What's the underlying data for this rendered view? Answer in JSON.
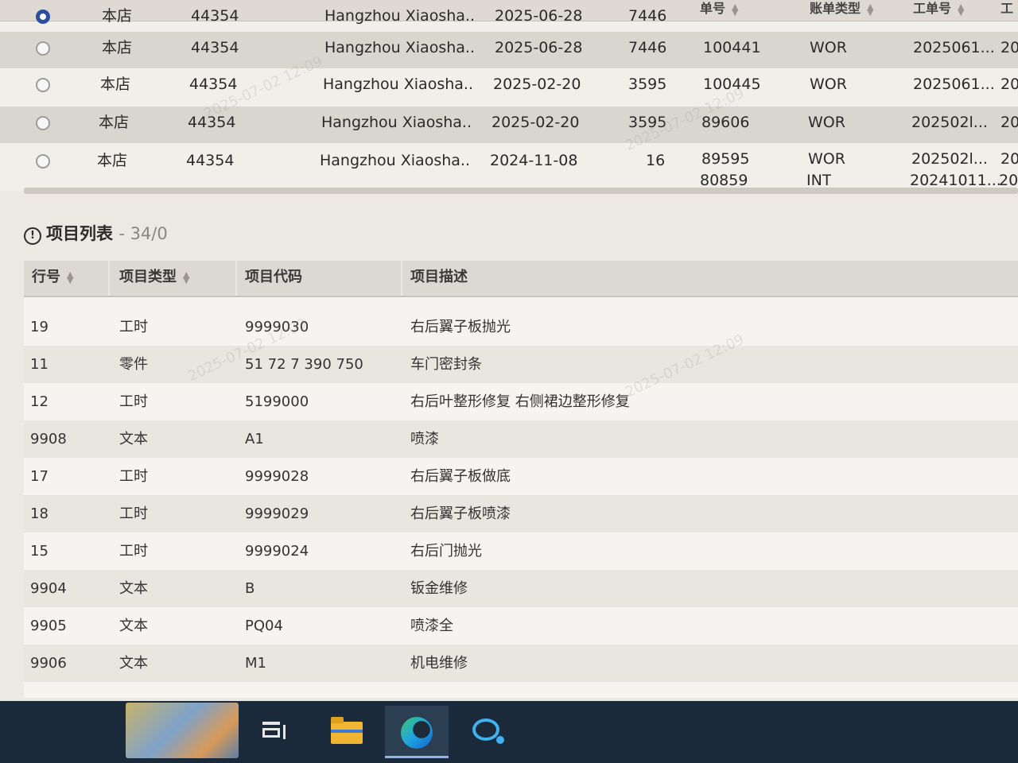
{
  "upper_table": {
    "header_labels": [
      "单号",
      "账单类型",
      "工单号",
      "工"
    ],
    "rows": [
      {
        "selected": true,
        "store": "本店",
        "code": "44354",
        "company": "Hangzhou Xiaosha...",
        "date": "2025-06-28",
        "num": "7446",
        "bill_no": "",
        "type": "",
        "order_no": "",
        "extra": ""
      },
      {
        "selected": false,
        "store": "本店",
        "code": "44354",
        "company": "Hangzhou Xiaosha...",
        "date": "2025-06-28",
        "num": "7446",
        "bill_no": "100441",
        "type": "WOR",
        "order_no": "2025061...",
        "extra": "20"
      },
      {
        "selected": false,
        "store": "本店",
        "code": "44354",
        "company": "Hangzhou Xiaosha...",
        "date": "2025-02-20",
        "num": "3595",
        "bill_no": "100445",
        "type": "WOR",
        "order_no": "2025061...",
        "extra": "20"
      },
      {
        "selected": false,
        "store": "本店",
        "code": "44354",
        "company": "Hangzhou Xiaosha...",
        "date": "2025-02-20",
        "num": "3595",
        "bill_no": "89606",
        "type": "WOR",
        "order_no": "202502l...",
        "extra": "20"
      },
      {
        "selected": false,
        "store": "本店",
        "code": "44354",
        "company": "Hangzhou Xiaosha...",
        "date": "2024-11-08",
        "num": "16",
        "bill_no": "89595",
        "type": "WOR",
        "order_no": "202502l...",
        "extra": "20"
      }
    ],
    "last_row": {
      "bill_no": "80859",
      "type": "INT",
      "order_no": "20241011...",
      "extra": "20"
    }
  },
  "items_section": {
    "title": "项目列表",
    "count": "- 34/0"
  },
  "items_table": {
    "columns": [
      "行号",
      "项目类型",
      "项目代码",
      "项目描述"
    ],
    "rows": [
      {
        "line": "19",
        "type": "工时",
        "code": "9999030",
        "desc": "右后翼子板抛光"
      },
      {
        "line": "11",
        "type": "零件",
        "code": "51 72 7 390 750",
        "desc": "车门密封条"
      },
      {
        "line": "12",
        "type": "工时",
        "code": "5199000",
        "desc": "右后叶整形修复 右侧裙边整形修复"
      },
      {
        "line": "9908",
        "type": "文本",
        "code": "A1",
        "desc": "喷漆"
      },
      {
        "line": "17",
        "type": "工时",
        "code": "9999028",
        "desc": "右后翼子板做底"
      },
      {
        "line": "18",
        "type": "工时",
        "code": "9999029",
        "desc": "右后翼子板喷漆"
      },
      {
        "line": "15",
        "type": "工时",
        "code": "9999024",
        "desc": "右后门抛光"
      },
      {
        "line": "9904",
        "type": "文本",
        "code": "B",
        "desc": "钣金维修"
      },
      {
        "line": "9905",
        "type": "文本",
        "code": "PQ04",
        "desc": "喷漆全"
      },
      {
        "line": "9906",
        "type": "文本",
        "code": "M1",
        "desc": "机电维修"
      }
    ]
  },
  "watermarks": [
    "2025-07-02 12:09",
    "2025-07-02 12:09",
    "2025-07-02 12:09",
    "2025-07-02 12:09"
  ],
  "taskbar": {
    "icons": [
      "task-view-icon",
      "file-explorer-icon",
      "edge-browser-icon",
      "chat-icon"
    ]
  }
}
